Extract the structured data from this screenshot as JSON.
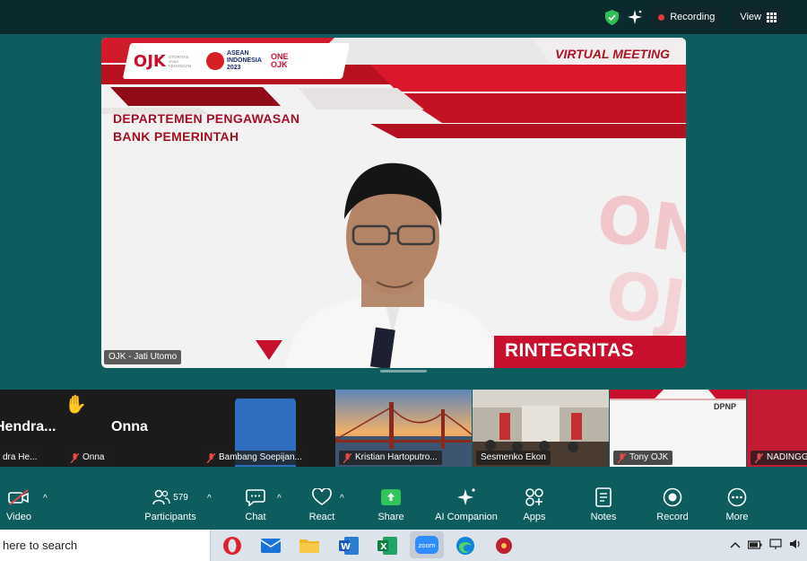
{
  "topbar": {
    "recording_label": "Recording",
    "view_label": "View",
    "colors": {
      "shield": "#2fbf57",
      "recording_dot": "#e5383b"
    }
  },
  "main_video": {
    "banner_title": "VIRTUAL MEETING",
    "department_line1": "DEPARTEMEN PENGAWASAN",
    "department_line2": "BANK PEMERINTAH",
    "ojk_logo_text": "OJK",
    "ojk_logo_small": "OTORITAS JASA KEUANGAN",
    "asean_text_1": "ASEAN",
    "asean_text_2": "INDONESIA",
    "asean_text_3": "2023",
    "one_ojk_1": "ONE",
    "one_ojk_2": "OJK",
    "watermark_1": "ONE",
    "watermark_2": "OJK",
    "bottom_banner": "RINTEGRITAS",
    "speaker_name": "OJK - Jati Utomo",
    "colors": {
      "red": "#c8102e",
      "dark_red": "#a21022"
    }
  },
  "gallery": {
    "tiles": [
      {
        "big_name": "Hendra...",
        "label": "dra He..."
      },
      {
        "big_name": "Onna",
        "label": "Onna"
      },
      {
        "label": "Bambang Soepijan..."
      },
      {
        "label": "Kristian Hartoputro..."
      },
      {
        "label": "Sesmenko Ekon"
      },
      {
        "label": "Tony OJK",
        "dpnp": "DPNP"
      },
      {
        "label": "NADINGG"
      }
    ]
  },
  "toolbar": {
    "video": "Video",
    "participants": "Participants",
    "participants_count": "579",
    "chat": "Chat",
    "react": "React",
    "share": "Share",
    "ai_companion": "AI Companion",
    "apps": "Apps",
    "notes": "Notes",
    "record": "Record",
    "more": "More",
    "colors": {
      "share": "#30c45a"
    }
  },
  "taskbar": {
    "search_text": "here to search",
    "zoom_label": "zoom"
  }
}
